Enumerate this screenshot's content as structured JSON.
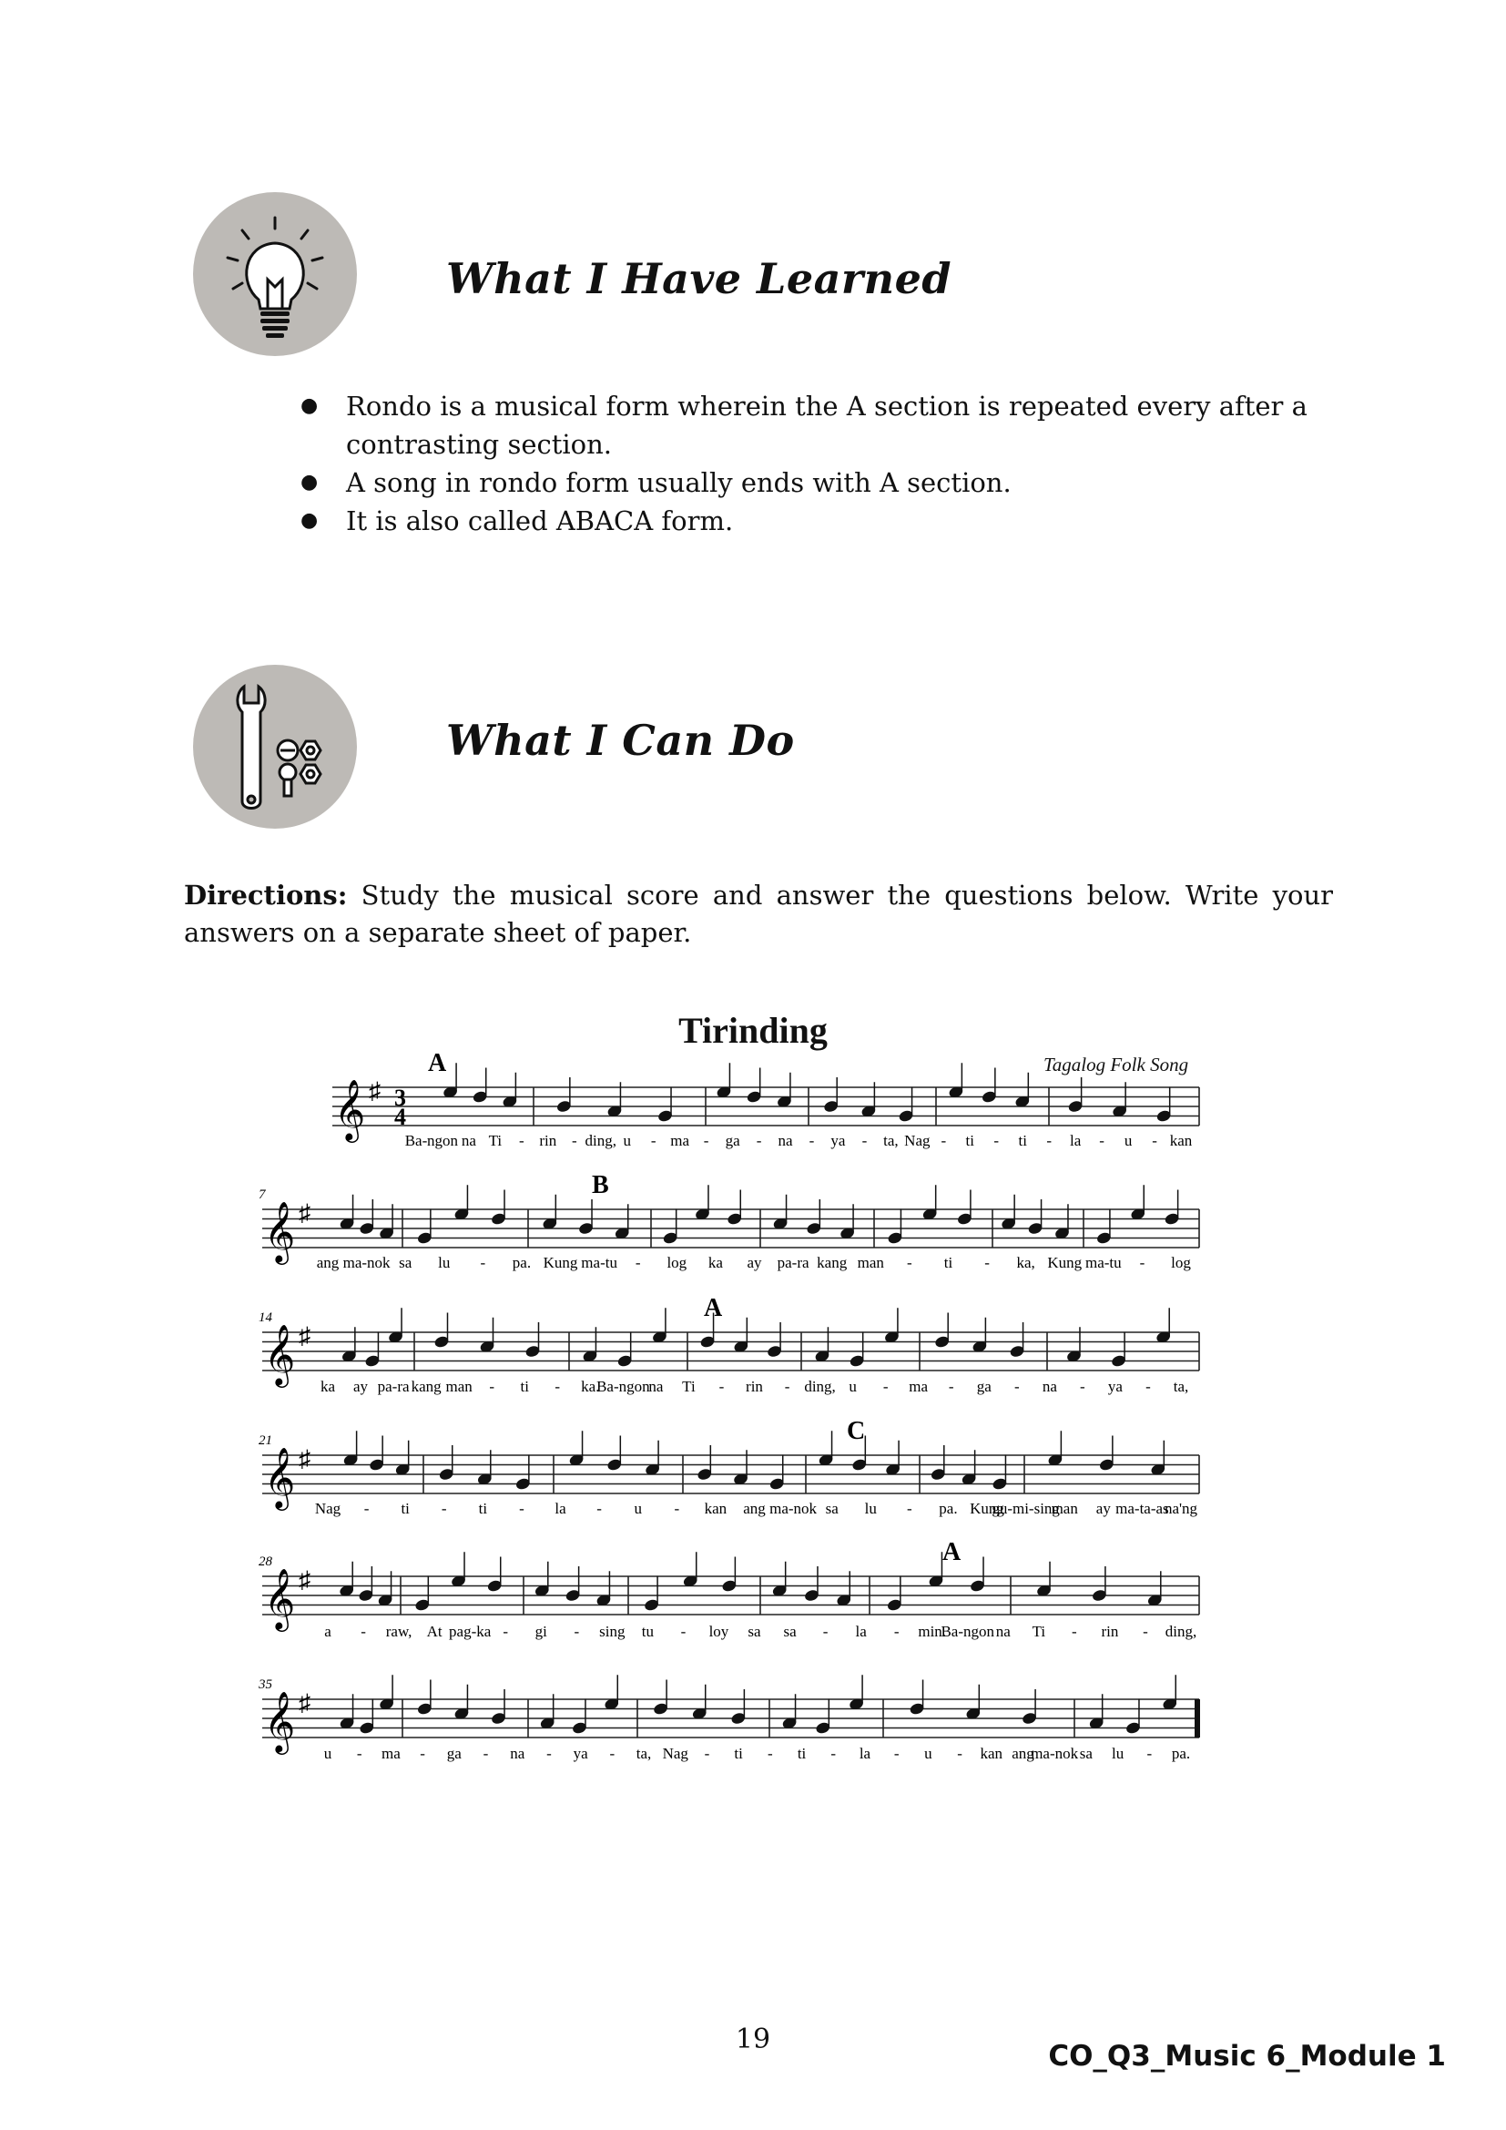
{
  "section1": {
    "title": "What I Have Learned",
    "icon": "lightbulb-icon"
  },
  "bullets": [
    "Rondo is a musical form wherein the A section is repeated every after a contrasting section.",
    "A song in rondo form usually ends with A section.",
    "It is also called ABACA form."
  ],
  "section2": {
    "title": "What I Can Do",
    "icon": "wrench-bolts-icon"
  },
  "directions": {
    "label": "Directions:",
    "text": " Study the musical score and answer the questions below. Write your answers on a separate sheet of paper."
  },
  "score": {
    "title": "Tirinding",
    "subtitle": "Tagalog Folk Song",
    "time_signature": [
      "3",
      "4"
    ],
    "key": "G major (one sharp)",
    "systems": [
      {
        "measure": "",
        "marks": [
          {
            "label": "A"
          }
        ],
        "lyrics": [
          "Ba-",
          "ngon",
          "na",
          "Ti",
          "-",
          "rin",
          "-",
          "ding,",
          "u",
          "-",
          "ma",
          "-",
          "ga",
          "-",
          "na",
          "-",
          "ya",
          "-",
          "ta,",
          "Nag",
          "-",
          "ti",
          "-",
          "ti",
          "-",
          "la",
          "-",
          "u",
          "-",
          "kan"
        ]
      },
      {
        "measure": "7",
        "marks": [
          {
            "label": "B"
          }
        ],
        "lyrics": [
          "ang",
          "ma-nok",
          "sa",
          "lu",
          "-",
          "pa.",
          "Kung",
          "ma-tu",
          "-",
          "log",
          "ka",
          "ay",
          "pa-ra",
          "kang",
          "man",
          "-",
          "ti",
          "-",
          "ka,",
          "Kung",
          "ma-tu",
          "-",
          "log"
        ]
      },
      {
        "measure": "14",
        "marks": [
          {
            "label": "A"
          }
        ],
        "lyrics": [
          "ka",
          "ay",
          "pa-ra",
          "kang",
          "man",
          "-",
          "ti",
          "-",
          "ka.",
          "Ba-ngon",
          "na",
          "Ti",
          "-",
          "rin",
          "-",
          "ding,",
          "u",
          "-",
          "ma",
          "-",
          "ga",
          "-",
          "na",
          "-",
          "ya",
          "-",
          "ta,"
        ]
      },
      {
        "measure": "21",
        "marks": [
          {
            "label": "C"
          }
        ],
        "lyrics": [
          "Nag",
          "-",
          "ti",
          "-",
          "ti",
          "-",
          "la",
          "-",
          "u",
          "-",
          "kan",
          "ang",
          "ma-nok",
          "sa",
          "lu",
          "-",
          "pa.",
          "Kung",
          "gu-mi-sing",
          "man",
          "ay",
          "ma-ta-as",
          "na'ng"
        ]
      },
      {
        "measure": "28",
        "marks": [
          {
            "label": "A"
          }
        ],
        "lyrics": [
          "a",
          "-",
          "raw,",
          "At",
          "pag-ka",
          "-",
          "gi",
          "-",
          "sing",
          "tu",
          "-",
          "loy",
          "sa",
          "sa",
          "-",
          "la",
          "-",
          "min.",
          "Ba-ngon",
          "na",
          "Ti",
          "-",
          "rin",
          "-",
          "ding,"
        ]
      },
      {
        "measure": "35",
        "marks": [],
        "lyrics": [
          "u",
          "-",
          "ma",
          "-",
          "ga",
          "-",
          "na",
          "-",
          "ya",
          "-",
          "ta,",
          "Nag",
          "-",
          "ti",
          "-",
          "ti",
          "-",
          "la",
          "-",
          "u",
          "-",
          "kan",
          "ang",
          "ma-nok",
          "sa",
          "lu",
          "-",
          "pa."
        ]
      }
    ]
  },
  "footer": {
    "page_number": "19",
    "code": "CO_Q3_Music 6_Module 1"
  }
}
